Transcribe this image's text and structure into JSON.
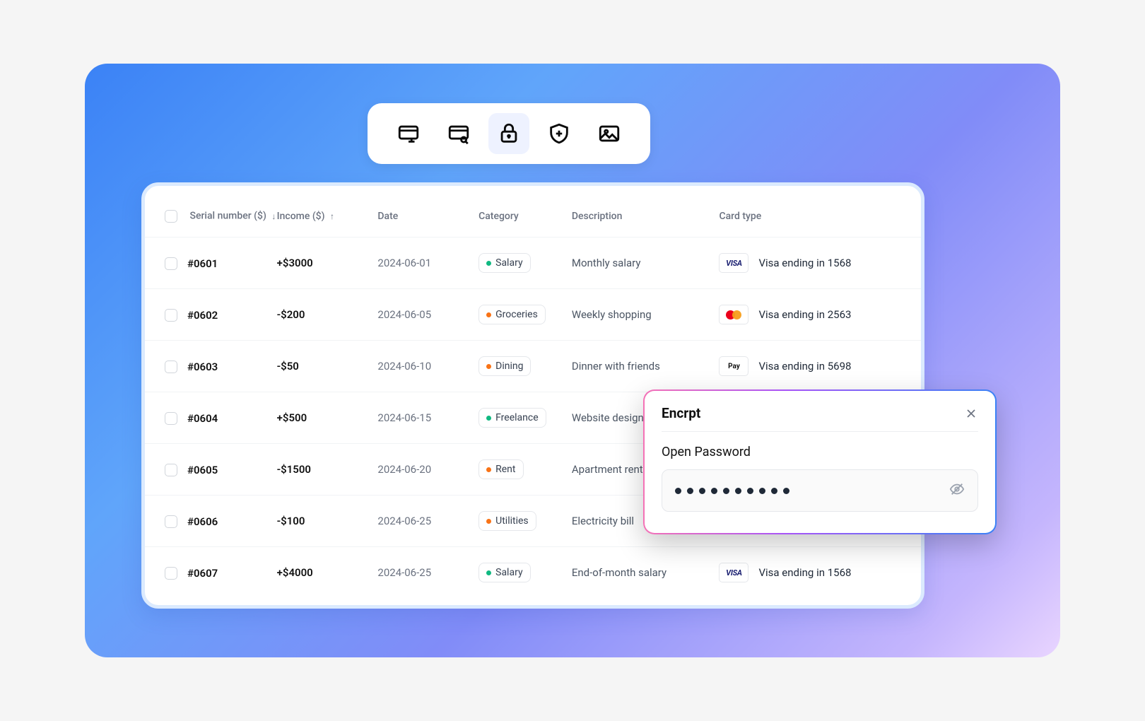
{
  "toolbar": {
    "items": [
      "card-text",
      "card-search",
      "lock",
      "shield-plus",
      "image"
    ],
    "activeIndex": 2
  },
  "table": {
    "headers": {
      "serial": "Serial number ($)",
      "income": "Income ($)",
      "date": "Date",
      "category": "Category",
      "description": "Description",
      "cardtype": "Card type"
    },
    "rows": [
      {
        "serial": "#0601",
        "income": "+$3000",
        "date": "2024-06-01",
        "category": "Salary",
        "catColor": "g",
        "description": "Monthly salary",
        "brand": "visa",
        "card": "Visa ending in 1568"
      },
      {
        "serial": "#0602",
        "income": "-$200",
        "date": "2024-06-05",
        "category": "Groceries",
        "catColor": "o",
        "description": "Weekly shopping",
        "brand": "mc",
        "card": "Visa ending in 2563"
      },
      {
        "serial": "#0603",
        "income": "-$50",
        "date": "2024-06-10",
        "category": "Dining",
        "catColor": "o",
        "description": "Dinner with friends",
        "brand": "apay",
        "card": "Visa ending in 5698"
      },
      {
        "serial": "#0604",
        "income": "+$500",
        "date": "2024-06-15",
        "category": "Freelance",
        "catColor": "g",
        "description": "Website design",
        "brand": "",
        "card": ""
      },
      {
        "serial": "#0605",
        "income": "-$1500",
        "date": "2024-06-20",
        "category": "Rent",
        "catColor": "o",
        "description": "Apartment rent",
        "brand": "",
        "card": ""
      },
      {
        "serial": "#0606",
        "income": "-$100",
        "date": "2024-06-25",
        "category": "Utilities",
        "catColor": "o",
        "description": "Electricity bill",
        "brand": "",
        "card": ""
      },
      {
        "serial": "#0607",
        "income": "+$4000",
        "date": "2024-06-25",
        "category": "Salary",
        "catColor": "g",
        "description": "End-of-month salary",
        "brand": "visa",
        "card": "Visa ending in 1568"
      }
    ]
  },
  "modal": {
    "title": "Encrpt",
    "label": "Open Password",
    "passwordLength": 10
  }
}
